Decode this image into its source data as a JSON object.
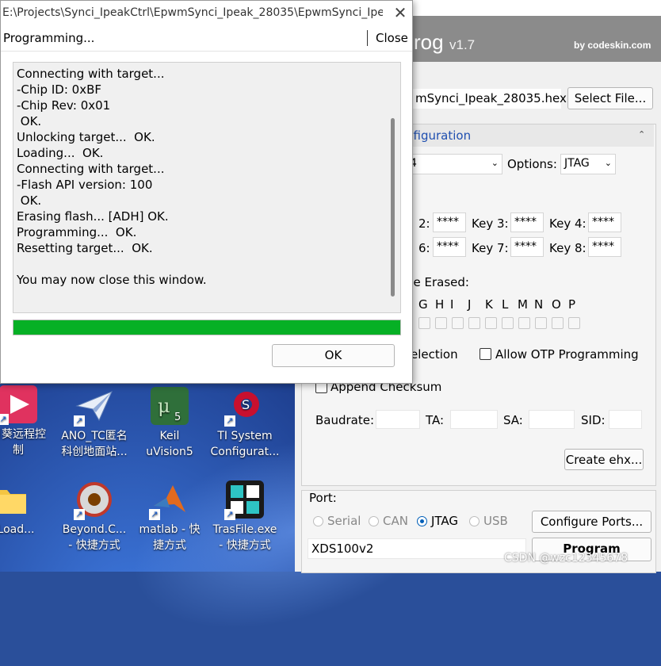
{
  "dialog": {
    "title": "E:\\Projects\\Synci_IpeakCtrl\\EpwmSynci_Ipeak_28035\\EpwmSynci_Ipeak...",
    "toolbar_title": "Programming...",
    "toolbar_close": "Close",
    "log_lines": [
      "Connecting with target...",
      "-Chip ID: 0xBF",
      "-Chip Rev: 0x01",
      " OK.",
      "Unlocking target...  OK.",
      "Loading...  OK.",
      "Connecting with target...",
      "-Flash API version: 100",
      " OK.",
      "Erasing flash... [ADH] OK.",
      "Programming...  OK.",
      "Resetting target...  OK.",
      "",
      "You may now close this window."
    ],
    "progress": 1.0,
    "ok_label": "OK"
  },
  "app": {
    "title_fragment": "rog",
    "version": "v1.7",
    "by": "by codeskin.com",
    "file_name": "mSynci_Ipeak_28035.hex",
    "select_file": "Select File...",
    "config_header": "nfiguration",
    "device_value": "4",
    "options_label": "Options:",
    "options_value": "JTAG",
    "keys": [
      {
        "label": "2:",
        "value": "****"
      },
      {
        "label": "Key 3:",
        "value": "****"
      },
      {
        "label": "Key 4:",
        "value": "****"
      },
      {
        "label": "6:",
        "value": "****"
      },
      {
        "label": "Key 7:",
        "value": "****"
      },
      {
        "label": "Key 8:",
        "value": "****"
      }
    ],
    "erase_label": "be Erased:",
    "sectors": [
      "G",
      "H",
      "I",
      "J",
      "K",
      "L",
      "M",
      "N",
      "O",
      "P"
    ],
    "selection_label": "election",
    "allow_otp": "Allow OTP Programming",
    "append_checksum": "Append Checksum",
    "baudrate_label": "Baudrate:",
    "ta_label": "TA:",
    "sa_label": "SA:",
    "sid_label": "SID:",
    "create_ehx": "Create ehx...",
    "port_label": "Port:",
    "port_options": [
      "Serial",
      "CAN",
      "JTAG",
      "USB"
    ],
    "port_selected": "JTAG",
    "configure_ports": "Configure Ports...",
    "emulator": "XDS100v2",
    "program": "Program"
  },
  "desktop_icons": [
    {
      "icon": "remote-control-icon",
      "label": "日葵远程控\n制"
    },
    {
      "icon": "paper-plane-icon",
      "label": "ANO_TC匿名\n科创地面站..."
    },
    {
      "icon": "keil-icon",
      "label": "Keil\nuVision5"
    },
    {
      "icon": "ti-gear-icon",
      "label": "TI System\nConfigurat..."
    },
    {
      "icon": "folder-icon",
      "label": "otLoad..."
    },
    {
      "icon": "beyond-compare-icon",
      "label": "Beyond.C...\n- 快捷方式"
    },
    {
      "icon": "matlab-icon",
      "label": "matlab - 快\n捷方式"
    },
    {
      "icon": "trasfile-icon",
      "label": "TrasFile.exe\n- 快捷方式"
    }
  ],
  "watermark": "CSDN @wzc12345678"
}
